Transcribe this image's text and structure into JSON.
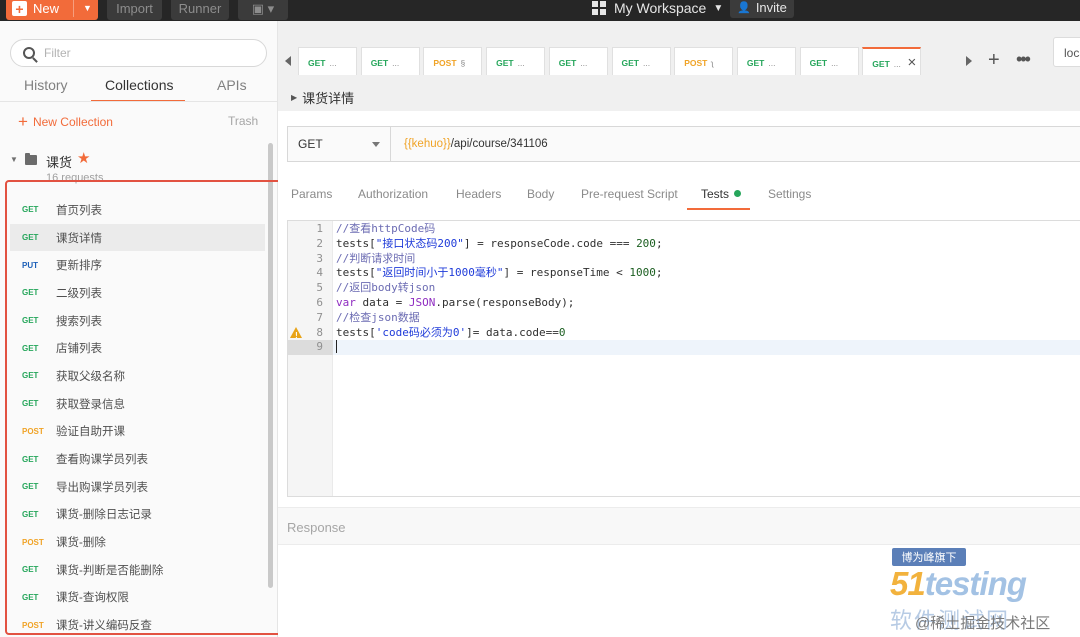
{
  "topbar": {
    "new_label": "New",
    "import_label": "Import",
    "runner_label": "Runner",
    "workspace": "My Workspace",
    "invite": "Invite"
  },
  "sidebar": {
    "filter_placeholder": "Filter",
    "tabs": [
      "History",
      "Collections",
      "APIs"
    ],
    "active_tab": "Collections",
    "new_collection": "New Collection",
    "trash": "Trash",
    "collection": {
      "name": "课货",
      "count": "16 requests",
      "requests": [
        {
          "method": "GET",
          "name": "首页列表"
        },
        {
          "method": "GET",
          "name": "课货详情"
        },
        {
          "method": "PUT",
          "name": "更新排序"
        },
        {
          "method": "GET",
          "name": "二级列表"
        },
        {
          "method": "GET",
          "name": "搜索列表"
        },
        {
          "method": "GET",
          "name": "店铺列表"
        },
        {
          "method": "GET",
          "name": "获取父级名称"
        },
        {
          "method": "GET",
          "name": "获取登录信息"
        },
        {
          "method": "POST",
          "name": "验证自助开课"
        },
        {
          "method": "GET",
          "name": "查看购课学员列表"
        },
        {
          "method": "GET",
          "name": "导出购课学员列表"
        },
        {
          "method": "GET",
          "name": "课货-删除日志记录"
        },
        {
          "method": "POST",
          "name": "课货-删除"
        },
        {
          "method": "GET",
          "name": "课货-判断是否能删除"
        },
        {
          "method": "GET",
          "name": "课货-查询权限"
        },
        {
          "method": "POST",
          "name": "课货-讲义编码反查"
        }
      ]
    }
  },
  "tabs": {
    "items": [
      {
        "method": "GET",
        "ell": "..."
      },
      {
        "method": "GET",
        "ell": "..."
      },
      {
        "method": "POST",
        "ell": "§"
      },
      {
        "method": "GET",
        "ell": "..."
      },
      {
        "method": "GET",
        "ell": "..."
      },
      {
        "method": "GET",
        "ell": "..."
      },
      {
        "method": "POST",
        "ell": "ʅ"
      },
      {
        "method": "GET",
        "ell": "..."
      },
      {
        "method": "GET",
        "ell": "..."
      },
      {
        "method": "GET",
        "ell": "..."
      }
    ],
    "env": "loca"
  },
  "request": {
    "title": "课货详情",
    "method": "GET",
    "url_var": "{{kehuo}}",
    "url_path": "/api/course/341106",
    "tabs": [
      "Params",
      "Authorization",
      "Headers",
      "Body",
      "Pre-request Script",
      "Tests",
      "Settings"
    ],
    "active_tab": "Tests"
  },
  "editor": {
    "lines": [
      "//查看httpCode码",
      "tests[\"接口状态码200\"] = responseCode.code === 200;",
      "//判断请求时间",
      "tests[\"返回时间小于1000毫秒\"] = responseTime < 1000;",
      "//返回body转json",
      "var data = JSON.parse(responseBody);",
      "//检查json数据",
      "tests['code码必须为0']= data.code==0",
      ""
    ]
  },
  "response": {
    "label": "Response"
  },
  "watermark": {
    "badge": "博为峰旗下",
    "logo_num": "51",
    "logo_text": "testing",
    "sub": "软件测试网",
    "handle": "@稀土掘金技术社区"
  },
  "colors": {
    "accent": "#f26b3a",
    "get": "#26a65b",
    "put": "#1d60b8",
    "post": "#f0a326",
    "highlight_box": "#e25241"
  }
}
